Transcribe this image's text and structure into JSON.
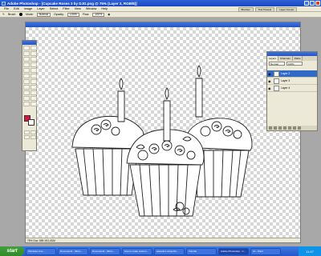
{
  "window": {
    "title": "Adobe Photoshop - [Cupcake Roses 3 by DJG.png @ 75% (Layer 2, RGB/8)]"
  },
  "menu": {
    "items": [
      "File",
      "Edit",
      "Image",
      "Layer",
      "Select",
      "Filter",
      "View",
      "Window",
      "Help"
    ],
    "panel_tabs": [
      "Brushes",
      "Tool Presets",
      "Layer Comps"
    ]
  },
  "options": {
    "brush_label": "Brush:",
    "mode_label": "Mode:",
    "mode_value": "Normal",
    "opacity_label": "Opacity:",
    "opacity_value": "100%",
    "flow_label": "Flow:",
    "flow_value": "100%"
  },
  "document": {
    "status_zoom": "75%",
    "status_doc": "Doc: 659.1K/1.81M"
  },
  "toolbox": {
    "foreground_color": "#e0113e",
    "background_color": "#ffffff"
  },
  "layers_panel": {
    "tabs": [
      "Layers",
      "Channels",
      "Paths"
    ],
    "blend_mode": "Normal",
    "opacity": "100%",
    "layers": [
      {
        "name": "Layer 2",
        "selected": true
      },
      {
        "name": "Layer 3",
        "selected": false
      },
      {
        "name": "Layer 4",
        "selected": false
      }
    ]
  },
  "taskbar": {
    "start_label": "start",
    "tasks": [
      "Windows Live ...",
      "Document1 - Micro...",
      "Document2 - Micro...",
      "how to make custom...",
      "sweetie's scrap Ro...",
      "Tutorial",
      "Adobe Photoshop - C...",
      "10 - Paint"
    ],
    "clock": "11:47"
  }
}
